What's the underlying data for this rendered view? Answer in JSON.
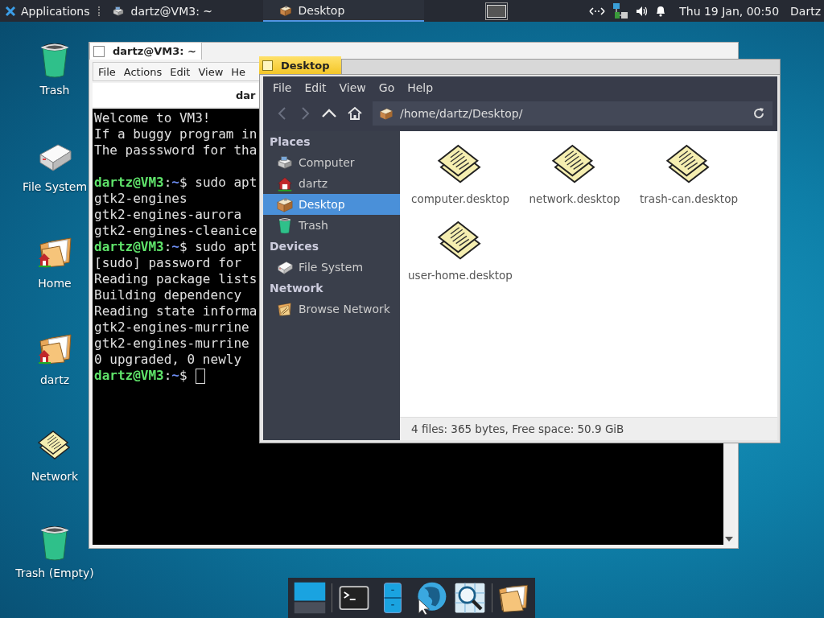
{
  "panel": {
    "apps_menu": "Applications",
    "tasks": [
      {
        "label": "dartz@VM3: ~",
        "kind": "terminal",
        "selected": false
      },
      {
        "label": "Desktop",
        "kind": "desk",
        "selected": true
      }
    ],
    "clock": "Thu 19 Jan, 00:50",
    "user": "Dartz"
  },
  "desktop_icons": [
    {
      "label": "Trash",
      "kind": "trash"
    },
    {
      "label": "File System",
      "kind": "drive"
    },
    {
      "label": "Home",
      "kind": "homefolder"
    },
    {
      "label": "dartz",
      "kind": "homefolder"
    },
    {
      "label": "Network",
      "kind": "note"
    },
    {
      "label": "Trash (Empty)",
      "kind": "trash"
    }
  ],
  "terminal": {
    "title": "dartz@VM3: ~",
    "menu": [
      "File",
      "Actions",
      "Edit",
      "View",
      "He"
    ],
    "tab_label": "dar",
    "lines": [
      {
        "kind": "text",
        "text": "Welcome to VM3!"
      },
      {
        "kind": "text",
        "text": "If a buggy program in"
      },
      {
        "kind": "text",
        "text": "The passsword for tha"
      },
      {
        "kind": "blank"
      },
      {
        "kind": "prompt",
        "user": "dartz@VM3",
        "sep": ":",
        "path": "~",
        "command": "$ sudo apt"
      },
      {
        "kind": "text",
        "text": "gtk2-engines"
      },
      {
        "kind": "text",
        "text": "gtk2-engines-aurora"
      },
      {
        "kind": "text",
        "text": "gtk2-engines-cleanice"
      },
      {
        "kind": "prompt",
        "user": "dartz@VM3",
        "sep": ":",
        "path": "~",
        "command": "$ sudo apt"
      },
      {
        "kind": "text",
        "text": "[sudo] password for"
      },
      {
        "kind": "text",
        "text": "Reading package lists"
      },
      {
        "kind": "text",
        "text": "Building dependency"
      },
      {
        "kind": "text",
        "text": "Reading state informa"
      },
      {
        "kind": "text",
        "text": "gtk2-engines-murrine"
      },
      {
        "kind": "text",
        "text": "gtk2-engines-murrine"
      },
      {
        "kind": "text",
        "text": "0 upgraded, 0 newly"
      },
      {
        "kind": "prompt",
        "user": "dartz@VM3",
        "sep": ":",
        "path": "~",
        "command": "$",
        "cursor": true
      }
    ]
  },
  "file_manager": {
    "title": "Desktop",
    "menu": [
      "File",
      "Edit",
      "View",
      "Go",
      "Help"
    ],
    "path": "/home/dartz/Desktop/",
    "sidebar": [
      {
        "header": "Places",
        "items": [
          {
            "label": "Computer",
            "kind": "computer",
            "selected": false
          },
          {
            "label": "dartz",
            "kind": "house",
            "selected": false
          },
          {
            "label": "Desktop",
            "kind": "desk",
            "selected": true
          },
          {
            "label": "Trash",
            "kind": "trash",
            "selected": false
          }
        ]
      },
      {
        "header": "Devices",
        "items": [
          {
            "label": "File System",
            "kind": "drive",
            "selected": false
          }
        ]
      },
      {
        "header": "Network",
        "items": [
          {
            "label": "Browse Network",
            "kind": "netfolder",
            "selected": false
          }
        ]
      }
    ],
    "files": [
      {
        "name": "computer.desktop"
      },
      {
        "name": "network.desktop"
      },
      {
        "name": "trash-can.desktop"
      },
      {
        "name": "user-home.desktop"
      }
    ],
    "status": "4 files: 365 bytes, Free space: 50.9 GiB"
  },
  "dock": [
    {
      "kind": "workspace"
    },
    {
      "kind": "separator"
    },
    {
      "kind": "terminal"
    },
    {
      "kind": "cabinet"
    },
    {
      "kind": "globe"
    },
    {
      "kind": "search"
    },
    {
      "kind": "separator"
    },
    {
      "kind": "folder"
    }
  ]
}
